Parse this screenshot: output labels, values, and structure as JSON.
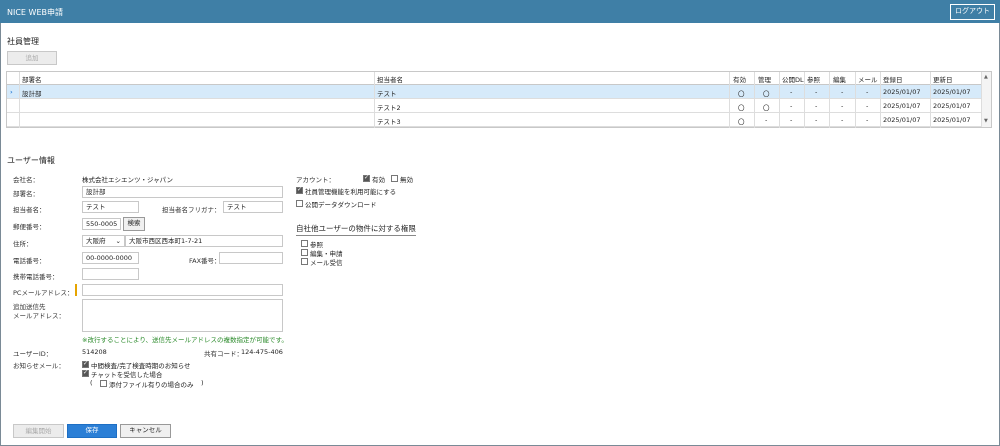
{
  "app": {
    "title": "NICE WEB申請",
    "logout_label": "ログアウト"
  },
  "staff": {
    "section_title": "社員管理",
    "add_label": "追加",
    "columns": {
      "dept": "部署名",
      "person": "担当者名",
      "valid": "有効",
      "manage": "管理",
      "public_dl": "公開DL",
      "ref": "参照",
      "edit": "編集",
      "mail": "メール",
      "registered": "登録日",
      "updated": "更新日"
    },
    "rows": [
      {
        "dept": "設計部",
        "person": "テスト",
        "valid": "〇",
        "manage": "〇",
        "public_dl": "-",
        "ref": "-",
        "edit": "-",
        "mail": "-",
        "registered": "2025/01/07",
        "updated": "2025/01/07"
      },
      {
        "dept": "",
        "person": "テスト2",
        "valid": "〇",
        "manage": "〇",
        "public_dl": "-",
        "ref": "-",
        "edit": "-",
        "mail": "-",
        "registered": "2025/01/07",
        "updated": "2025/01/07"
      },
      {
        "dept": "",
        "person": "テスト3",
        "valid": "〇",
        "manage": "-",
        "public_dl": "-",
        "ref": "-",
        "edit": "-",
        "mail": "-",
        "registered": "2025/01/07",
        "updated": "2025/01/07"
      }
    ]
  },
  "user": {
    "section_title": "ユーザー情報",
    "company_label": "会社名：",
    "company_value": "株式会社エシエンツ・ジャパン",
    "dept_label": "部署名：",
    "dept_value": "設計部",
    "person_label": "担当者名：",
    "person_value": "テスト",
    "kana_label": "担当者名フリガナ：",
    "kana_value": "テスト",
    "zip_label": "郵便番号：",
    "zip_value": "550-0005",
    "zip_search_label": "検索",
    "address_label": "住所：",
    "pref_value": "大阪府",
    "address_value": "大阪市西区西本町1-7-21",
    "phone_label": "電話番号：",
    "phone_value": "00-0000-0000",
    "fax_label": "FAX番号：",
    "fax_value": "",
    "mobile_label": "携帯電話番号：",
    "mobile_value": "",
    "pcmail_label": "PCメールアドレス：",
    "pcmail_value": "",
    "extra_mail_label_1": "追加送信先",
    "extra_mail_label_2": "メールアドレス：",
    "extra_mail_note": "※改行することにより、送信先メールアドレスの複数指定が可能です。",
    "userid_label": "ユーザーID：",
    "userid_value": "514208",
    "shared_code_label": "共有コード：",
    "shared_code_value": "124-475-406",
    "notify_label": "お知らせメール：",
    "notify_1": "中間検査/完了検査時期のお知らせ",
    "notify_2": "チャットを受信した場合",
    "notify_3_open": "(",
    "notify_3": "添付ファイル有りの場合のみ",
    "notify_3_close": ")"
  },
  "account": {
    "label": "アカウント：",
    "valid_label": "有効",
    "invalid_label": "無効",
    "use_staff_mgmt": "社員管理機能を利用可能にする",
    "public_download": "公開データダウンロード",
    "perm_title": "自社他ユーザーの物件に対する権限",
    "perm_ref": "参照",
    "perm_edit": "編集・申請",
    "perm_mail": "メール受信"
  },
  "footer": {
    "edit_start_label": "編集開始",
    "save_label": "保存",
    "cancel_label": "キャンセル"
  }
}
